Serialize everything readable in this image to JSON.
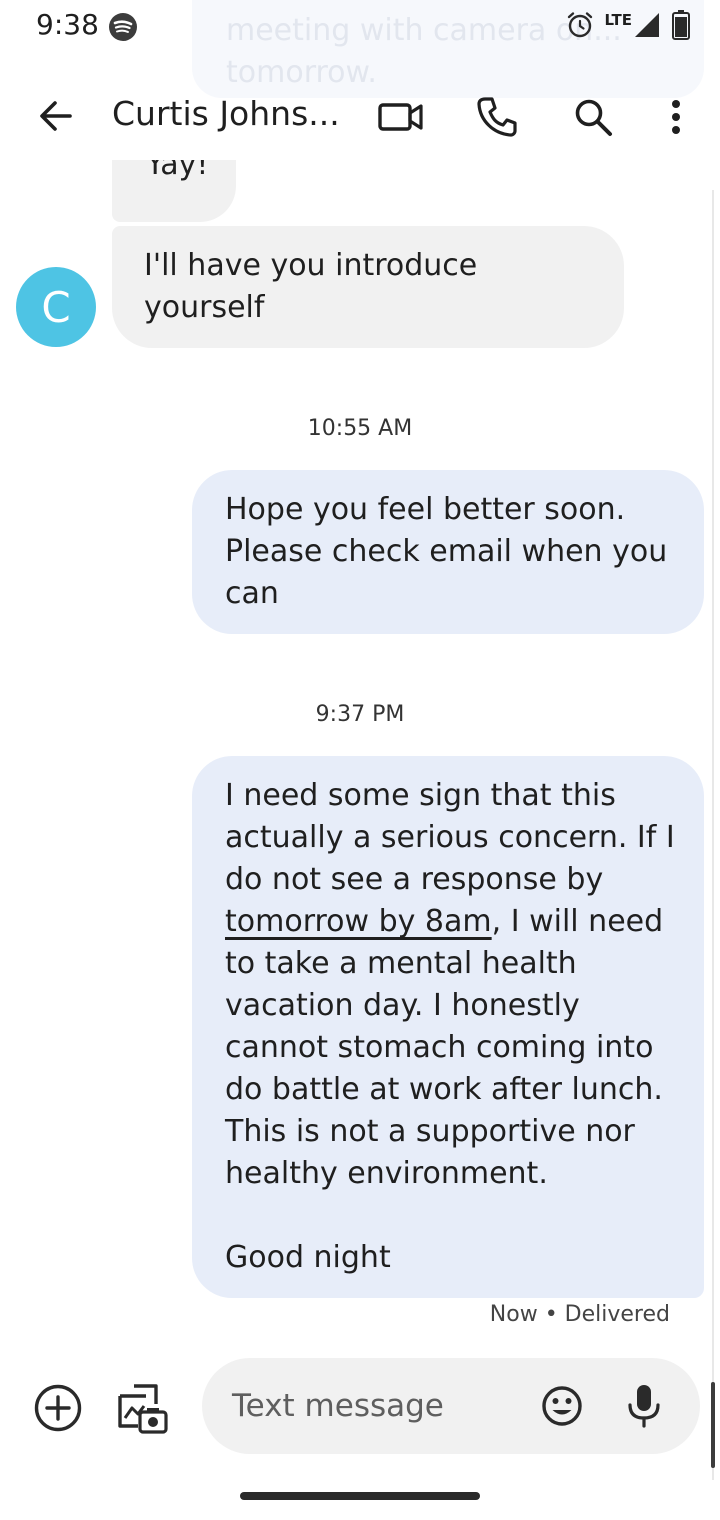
{
  "status_bar": {
    "time": "9:38",
    "network": "LTE",
    "icons": [
      "spotify-icon",
      "alarm-icon",
      "signal-icon",
      "battery-icon"
    ]
  },
  "notification_peek": {
    "text": "meeting with camera on... tomorrow."
  },
  "app_bar": {
    "contact_name": "Curtis Johns...",
    "icons": [
      "back-arrow-icon",
      "video-call-icon",
      "phone-icon",
      "search-icon",
      "more-vert-icon"
    ]
  },
  "contact": {
    "avatar_letter": "C",
    "avatar_color": "#4ec4e4"
  },
  "messages": {
    "yay": "Yay!",
    "intro": "I'll have you introduce yourself",
    "timestamp_1": "10:55 AM",
    "hope": "Hope you feel better soon. Please check email when you can",
    "timestamp_2": "9:37 PM",
    "long_part_1": "I need some sign that this actually a serious concern. If I do not see a response by ",
    "long_link": "tomorrow by 8am",
    "long_part_2": ", I will need to take a mental health vacation day. I honestly cannot stomach coming into do battle at work after lunch. This is not a supportive nor healthy environment.",
    "long_closing": "Good night",
    "delivery_status": "Now • Delivered"
  },
  "compose": {
    "placeholder": "Text message",
    "icons": [
      "add-icon",
      "gallery-icon",
      "emoji-icon",
      "mic-icon"
    ]
  },
  "colors": {
    "incoming_bubble": "#f1f1f1",
    "outgoing_bubble": "#e7edf9",
    "accent_avatar": "#4ec4e4"
  }
}
